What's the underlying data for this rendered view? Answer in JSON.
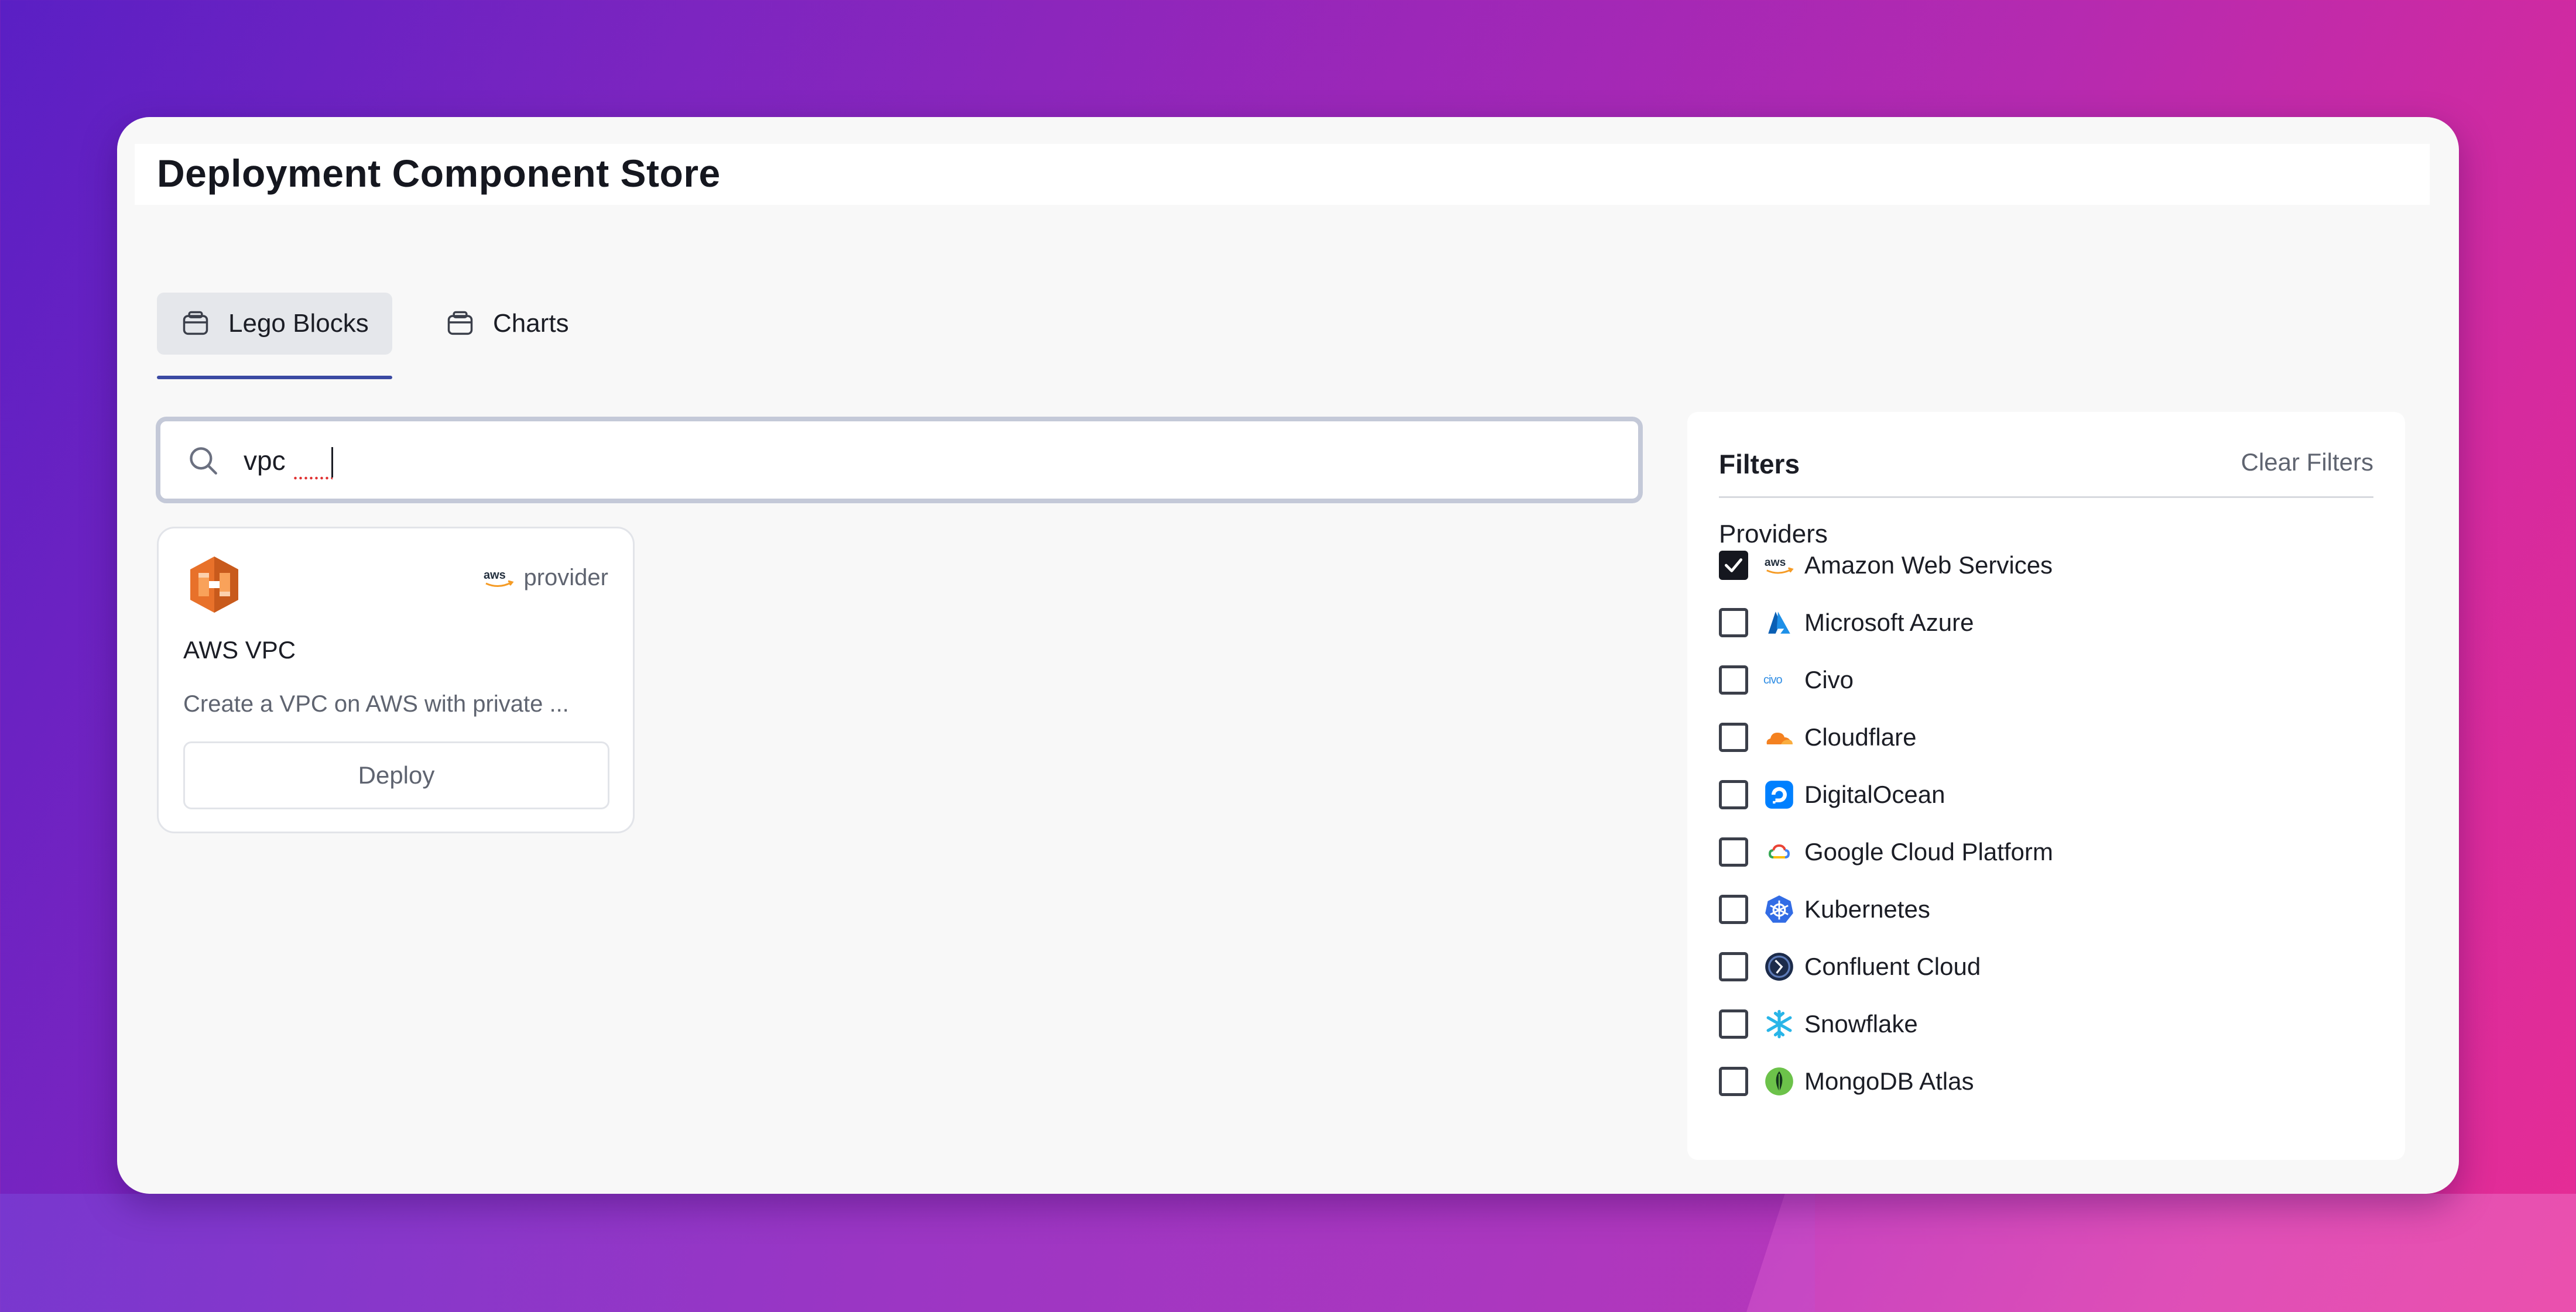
{
  "app": {
    "title": "Deployment Component Store"
  },
  "tabs": [
    {
      "label": "Lego Blocks",
      "icon": "block-icon",
      "active": true
    },
    {
      "label": "Charts",
      "icon": "block-icon",
      "active": false
    }
  ],
  "search": {
    "value": "vpc",
    "placeholder": ""
  },
  "results": [
    {
      "title": "AWS VPC",
      "description": "Create a VPC on AWS with private ...",
      "provider_label": "provider",
      "provider_icon": "aws-icon",
      "logo_icon": "aws-vpc-logo-icon",
      "deploy_label": "Deploy"
    }
  ],
  "filters": {
    "title": "Filters",
    "clear_label": "Clear Filters",
    "providers_label": "Providers",
    "providers": [
      {
        "name": "Amazon Web Services",
        "checked": true,
        "icon": "aws-icon"
      },
      {
        "name": "Microsoft Azure",
        "checked": false,
        "icon": "azure-icon"
      },
      {
        "name": "Civo",
        "checked": false,
        "icon": "civo-icon"
      },
      {
        "name": "Cloudflare",
        "checked": false,
        "icon": "cloudflare-icon"
      },
      {
        "name": "DigitalOcean",
        "checked": false,
        "icon": "digitalocean-icon"
      },
      {
        "name": "Google Cloud Platform",
        "checked": false,
        "icon": "gcp-icon"
      },
      {
        "name": "Kubernetes",
        "checked": false,
        "icon": "kubernetes-icon"
      },
      {
        "name": "Confluent Cloud",
        "checked": false,
        "icon": "confluent-icon"
      },
      {
        "name": "Snowflake",
        "checked": false,
        "icon": "snowflake-icon"
      },
      {
        "name": "MongoDB Atlas",
        "checked": false,
        "icon": "mongodb-icon"
      }
    ]
  },
  "colors": {
    "tab_underline": "#3b4aa3",
    "search_border": "#c4c9d8",
    "aws_orange": "#f58536",
    "checkbox_checked": "#15171f"
  }
}
